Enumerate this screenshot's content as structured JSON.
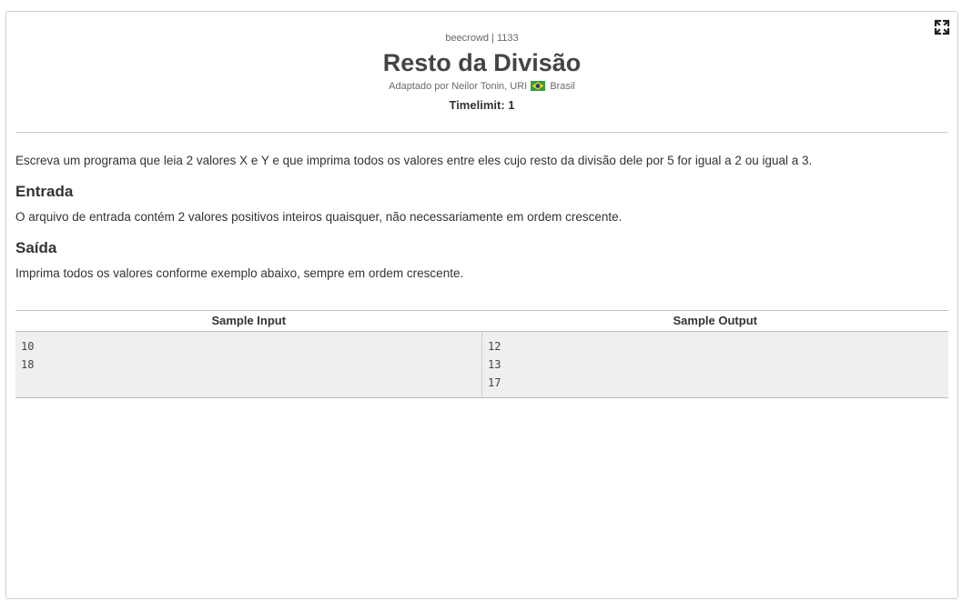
{
  "problem": {
    "source": "beecrowd | 1133",
    "title": "Resto da Divisão",
    "author_prefix": "Adaptado por Neilor Tonin, URI",
    "country": "Brasil",
    "timelimit": "Timelimit: 1"
  },
  "description": "Escreva um programa que leia 2 valores X e Y e que imprima todos os valores entre eles cujo resto da divisão dele por 5 for igual a 2 ou igual a 3.",
  "input_section": {
    "heading": "Entrada",
    "text": "O arquivo de entrada contém 2 valores positivos inteiros quaisquer, não necessariamente em ordem crescente."
  },
  "output_section": {
    "heading": "Saída",
    "text": "Imprima todos os valores conforme exemplo abaixo, sempre em ordem crescente."
  },
  "samples": {
    "input_header": "Sample Input",
    "output_header": "Sample Output",
    "input_lines": [
      "10",
      "18"
    ],
    "output_lines": [
      "12",
      "13",
      "17"
    ]
  },
  "icons": {
    "expand": "expand-icon",
    "flag": "brazil-flag-icon"
  }
}
